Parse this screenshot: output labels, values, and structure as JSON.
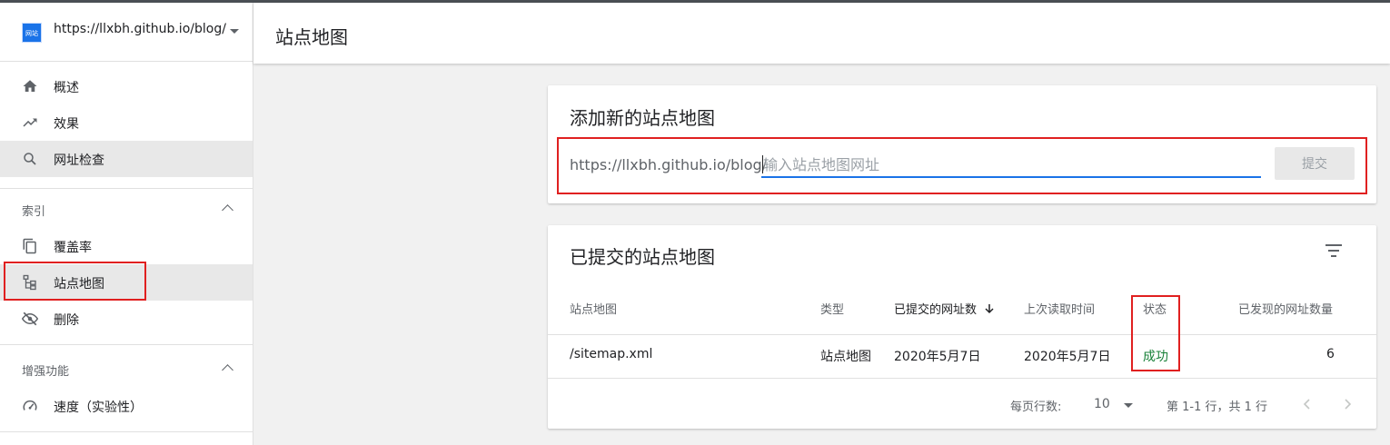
{
  "property": {
    "url": "https://llxbh.github.io/blog/",
    "logo_text": "网站"
  },
  "sidebar": {
    "top_items": [
      {
        "label": "概述",
        "icon": "home-icon"
      },
      {
        "label": "效果",
        "icon": "trending-up-icon"
      },
      {
        "label": "网址检查",
        "icon": "search-icon",
        "active": true
      }
    ],
    "index_section": {
      "title": "索引",
      "items": [
        {
          "label": "覆盖率",
          "icon": "copy-icon"
        },
        {
          "label": "站点地图",
          "icon": "sitemap-icon",
          "active": true
        },
        {
          "label": "删除",
          "icon": "eye-off-icon"
        }
      ]
    },
    "enhance_section": {
      "title": "增强功能",
      "items": [
        {
          "label": "速度（实验性）",
          "icon": "speedometer-icon"
        }
      ]
    }
  },
  "header": {
    "title": "站点地图"
  },
  "add_sitemap": {
    "title": "添加新的站点地图",
    "prefix": "https://llxbh.github.io/blog/",
    "placeholder": "输入站点地图网址",
    "submit_label": "提交"
  },
  "submitted": {
    "title": "已提交的站点地图",
    "columns": [
      "站点地图",
      "类型",
      "已提交的网址数",
      "上次读取时间",
      "状态",
      "已发现的网址数量"
    ],
    "rows": [
      {
        "sitemap": "/sitemap.xml",
        "type": "站点地图",
        "submitted": "2020年5月7日",
        "last_read": "2020年5月7日",
        "status": "成功",
        "discovered": "6"
      }
    ],
    "rows_per_page_label": "每页行数:",
    "rows_per_page": "10",
    "range_label": "第 1-1 行，共 1 行"
  },
  "colors": {
    "accent": "#1a73e8",
    "success": "#188038",
    "annotation": "#e02020"
  }
}
